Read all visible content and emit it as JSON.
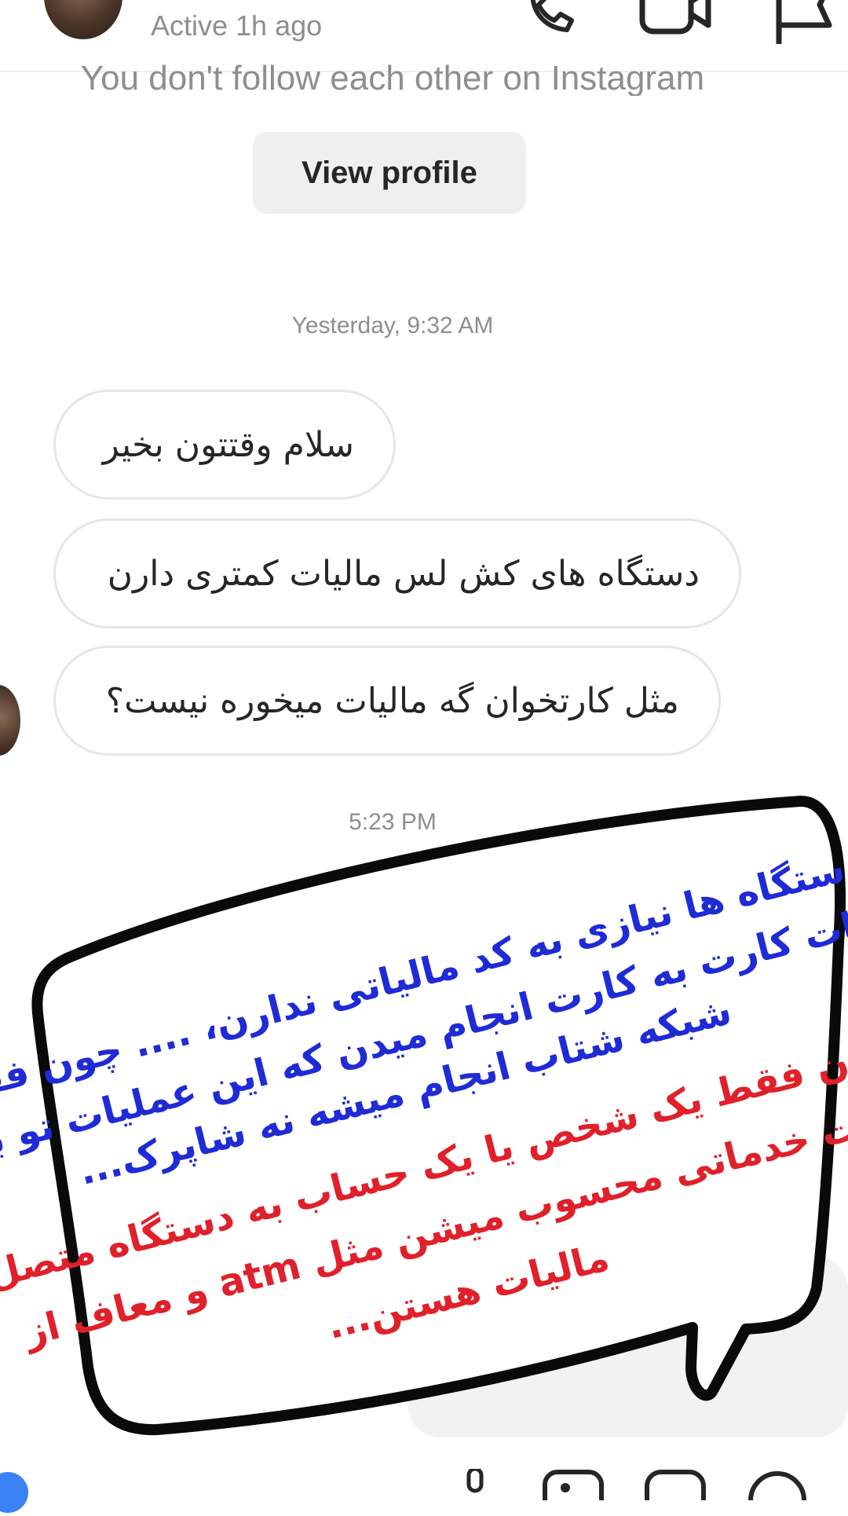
{
  "header": {
    "status": "Active 1h ago",
    "avatar_icon": "profile-photo",
    "call_icon": "phone-icon",
    "video_icon": "video-camera-icon",
    "flag_icon": "flag-icon"
  },
  "intro": {
    "follow_note": "You don't follow each other on Instagram",
    "view_profile_label": "View profile"
  },
  "messages": {
    "timestamp_1": "Yesterday, 9:32 AM",
    "bubbles": [
      "سلام وقتتون بخیر",
      "دستگاه های کش لس مالیات کمتری دارن",
      "مثل کارتخوان گه مالیات میخوره نیست؟"
    ],
    "timestamp_2": "5:23 PM"
  },
  "overlay": {
    "lines_blue": [
      "این دستگاه ها نیازی به کد مالیاتی ندارن، .... چون فقط",
      "عملیات کارت به کارت انجام میدن که این عملیات تو بستر",
      "شبکه شتاب انجام میشه نه شاپرک..."
    ],
    "lines_red": [
      "و چون فقط یک شخص یا یک حساب به دستگاه متصل",
      "نیست خدماتی محسوب میشن مثل atm و معاف از",
      "مالیات هستن..."
    ],
    "colors": {
      "blue": "#1f2bd6",
      "red": "#e0202a",
      "outline": "#0a0a0a"
    }
  },
  "composer": {
    "camera_icon": "camera-icon",
    "mic_icon": "microphone-icon",
    "gallery_icon": "gallery-icon",
    "sticker_icon": "sticker-icon",
    "add_icon": "plus-circle-icon"
  }
}
